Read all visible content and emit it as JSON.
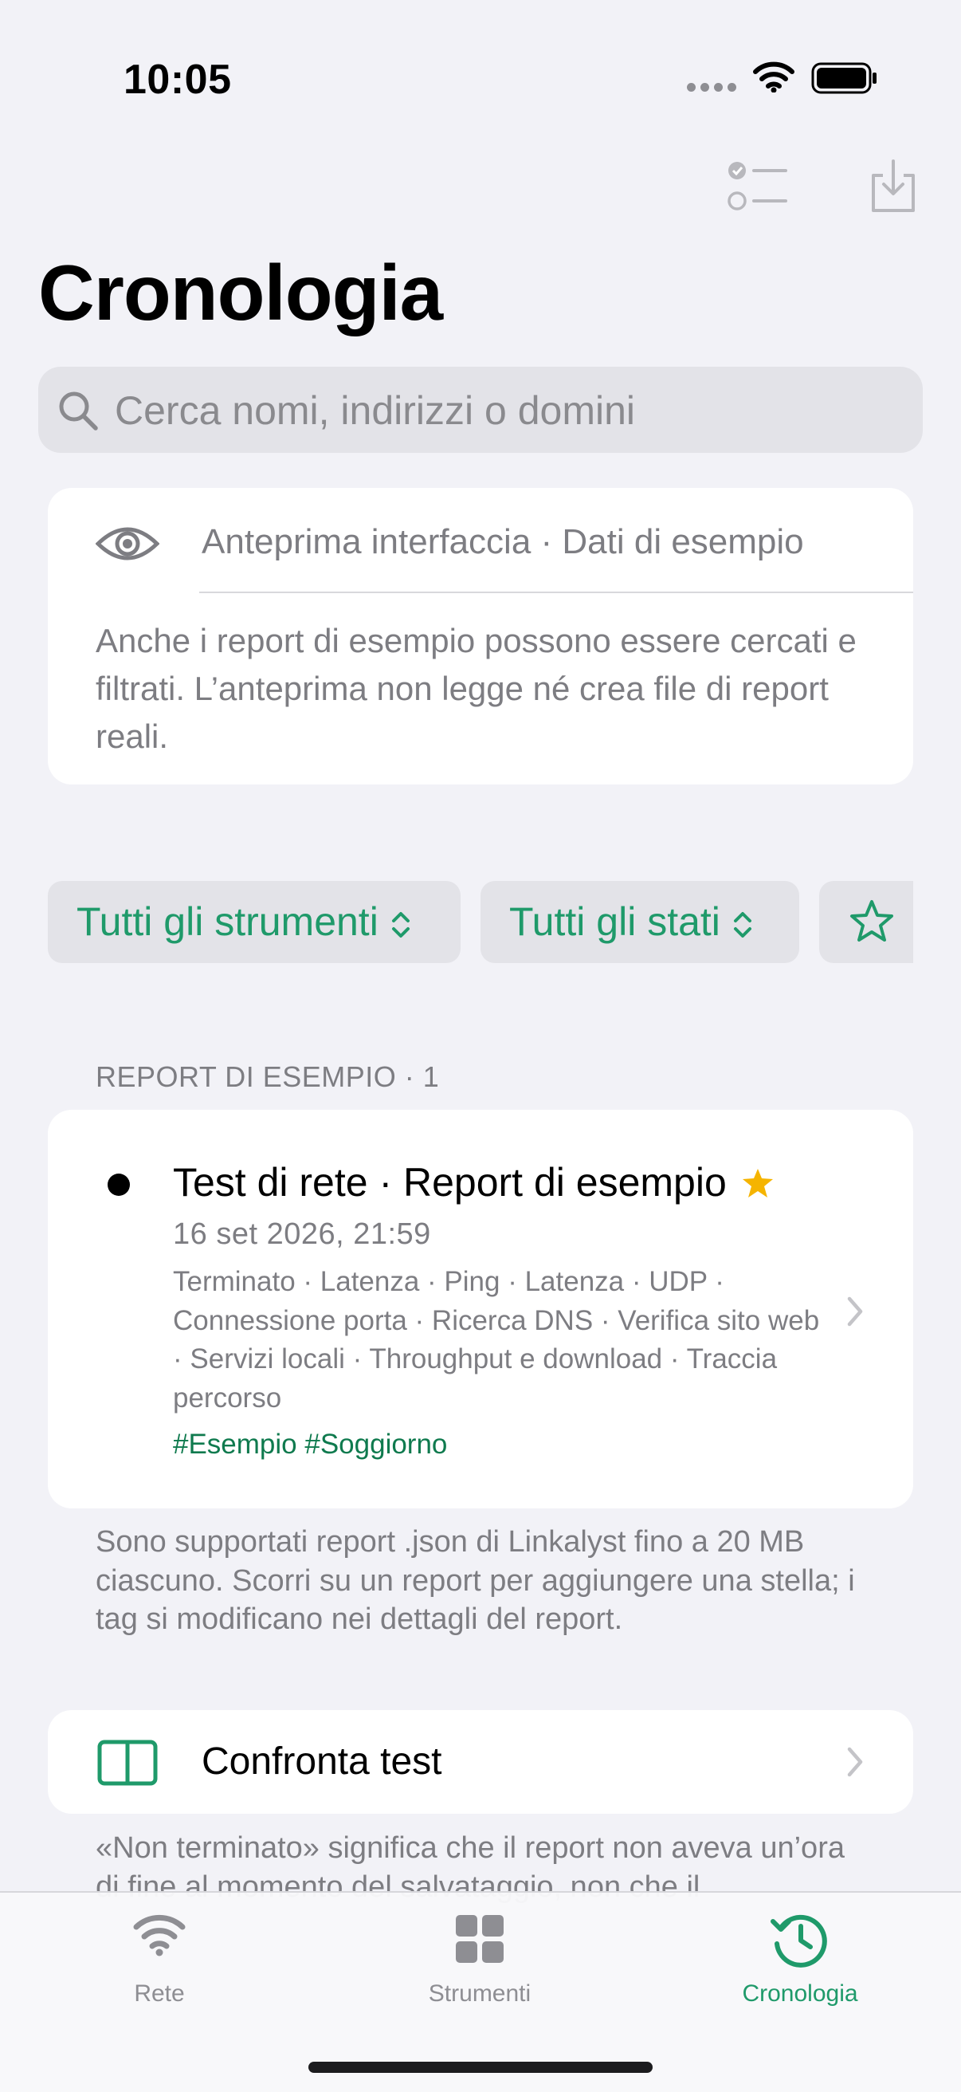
{
  "status_bar": {
    "time": "10:05"
  },
  "toolbar": {
    "select_icon": "checklist-icon",
    "import_icon": "tray-download-icon"
  },
  "page": {
    "title": "Cronologia"
  },
  "search": {
    "placeholder": "Cerca nomi, indirizzi o domini"
  },
  "notice": {
    "icon": "eye-icon",
    "heading": "Anteprima interfaccia · Dati di esempio",
    "body": "Anche i report di esempio possono essere cercati e filtrati. L’anteprima non legge né crea file di report reali."
  },
  "filters": {
    "tools_label": "Tutti gli strumenti",
    "status_label": "Tutti gli stati",
    "favorite_icon": "star-icon"
  },
  "section": {
    "header": "REPORT DI ESEMPIO · 1"
  },
  "report": {
    "title": "Test di rete · Report di esempio",
    "date": "16 set 2026, 21:59",
    "tools": "Terminato · Latenza · Ping · Latenza · UDP · Connessione porta · Ricerca DNS · Verifica sito web · Servizi locali · Throughput e download · Traccia percorso",
    "tags": "#Esempio #Soggiorno",
    "starred": true
  },
  "footer_note": "Sono supportati report .json di Linkalyst fino a 20 MB ciascuno. Scorri su un report per aggiungere una stella; i tag si modificano nei dettagli del report.",
  "compare": {
    "label": "Confronta test"
  },
  "bottom_note": "«Non terminato» significa che il report non aveva un’ora di fine al momento del salvataggio, non che il",
  "tabs": [
    {
      "label": "Rete",
      "icon": "wifi-icon",
      "active": false
    },
    {
      "label": "Strumenti",
      "icon": "grid-icon",
      "active": false
    },
    {
      "label": "Cronologia",
      "icon": "history-clock-icon",
      "active": true
    }
  ],
  "colors": {
    "accent": "#1f9a6a",
    "star": "#f5b400",
    "secondary_text": "#7d7d82",
    "background": "#f2f2f7"
  }
}
